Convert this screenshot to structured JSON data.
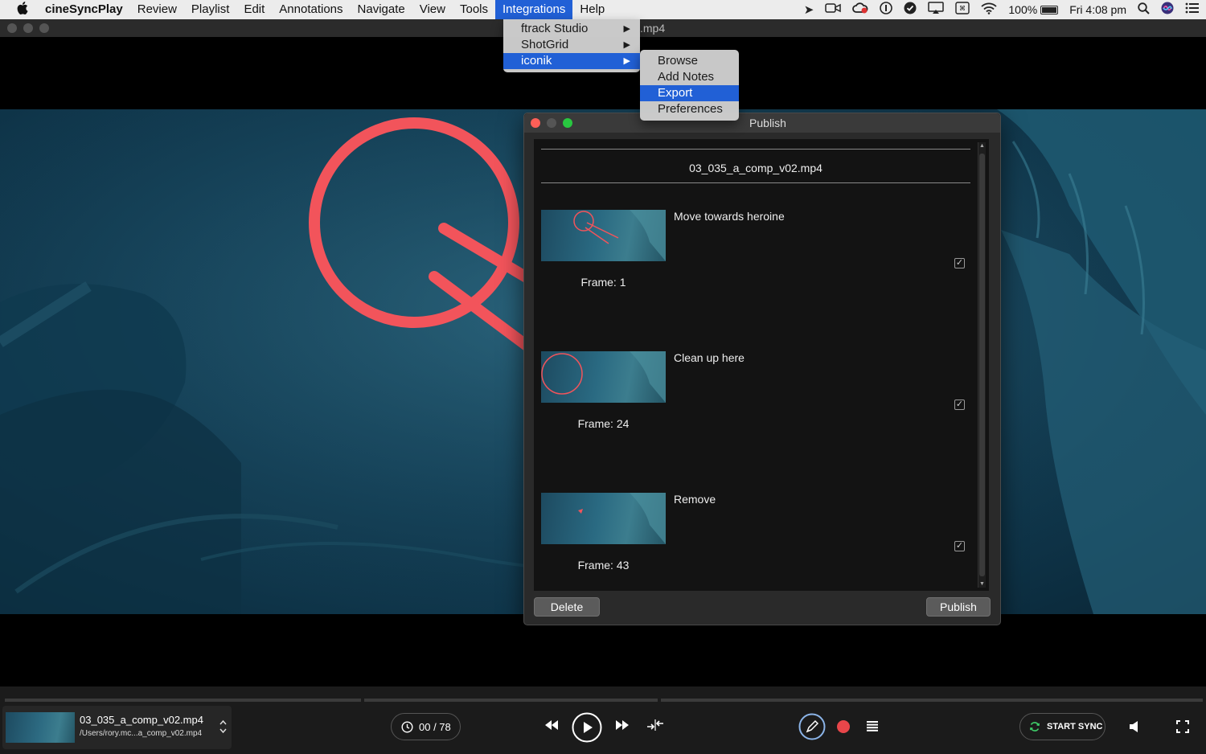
{
  "menubar": {
    "apple_icon": "apple-icon",
    "app_name": "cineSyncPlay",
    "menus": [
      "Review",
      "Playlist",
      "Edit",
      "Annotations",
      "Navigate",
      "View",
      "Tools",
      "Integrations",
      "Help"
    ],
    "active_menu": "Integrations",
    "battery_percent": "100%",
    "clock": "Fri 4:08 pm"
  },
  "window": {
    "title_fragment": ".mp4"
  },
  "integrations_menu": {
    "items": [
      {
        "label": "ftrack Studio",
        "has_submenu": true,
        "highlighted": false
      },
      {
        "label": "ShotGrid",
        "has_submenu": true,
        "highlighted": false
      },
      {
        "label": "iconik",
        "has_submenu": true,
        "highlighted": true
      }
    ],
    "submenu_arrow": "▶"
  },
  "iconik_submenu": {
    "items": [
      {
        "label": "Browse",
        "highlighted": false
      },
      {
        "label": "Add Notes",
        "highlighted": false
      },
      {
        "label": "Export",
        "highlighted": true
      },
      {
        "label": "Preferences",
        "highlighted": false
      }
    ]
  },
  "publish_dialog": {
    "title": "Publish",
    "media_name": "03_035_a_comp_v02.mp4",
    "notes": [
      {
        "text": "Move towards heroine",
        "frame_label": "Frame: 1",
        "checked": true
      },
      {
        "text": "Clean up here",
        "frame_label": "Frame: 24",
        "checked": true
      },
      {
        "text": "Remove",
        "frame_label": "Frame: 43",
        "checked": true
      }
    ],
    "check_glyph": "✓",
    "delete_label": "Delete",
    "publish_label": "Publish"
  },
  "player": {
    "media_name": "03_035_a_comp_v02.mp4",
    "media_path": "/Users/rory.mc...a_comp_v02.mp4",
    "frame_counter": "00 / 78",
    "sync_label": "START SYNC"
  },
  "colors": {
    "menu_highlight": "#2160d6",
    "annotation_red": "#f2545b",
    "record_red": "#e8464a",
    "dialog_bg": "#2a2a2a",
    "list_bg": "#131313"
  }
}
